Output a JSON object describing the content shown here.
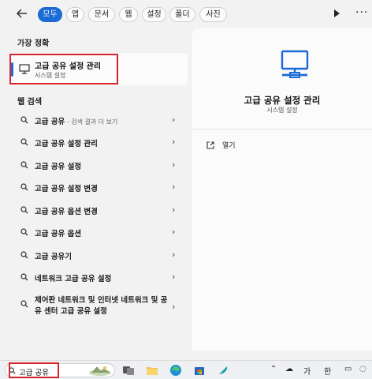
{
  "tabs": [
    {
      "label": "모두",
      "active": true
    },
    {
      "label": "앱",
      "active": false
    },
    {
      "label": "문서",
      "active": false
    },
    {
      "label": "웹",
      "active": false
    },
    {
      "label": "설정",
      "active": false
    },
    {
      "label": "폴더",
      "active": false
    },
    {
      "label": "사진",
      "active": false
    }
  ],
  "best_match": {
    "section_label": "가장 정확",
    "title": "고급 공유 설정 관리",
    "subtitle": "시스템 설정",
    "icon": "network-settings-icon"
  },
  "web_search": {
    "section_label": "웹 검색",
    "results": [
      {
        "label": "고급 공유",
        "suffix": " - 검색 결과 더 보기"
      },
      {
        "label": "고급 공유 설정 관리",
        "suffix": ""
      },
      {
        "label": "고급 공유 설정",
        "suffix": ""
      },
      {
        "label": "고급 공유 설정 변경",
        "suffix": ""
      },
      {
        "label": "고급 공유 옵션 변경",
        "suffix": ""
      },
      {
        "label": "고급 공유 옵션",
        "suffix": ""
      },
      {
        "label": "고급 공유기",
        "suffix": ""
      },
      {
        "label": "네트워크 고급 공유 설정",
        "suffix": ""
      },
      {
        "label": "제어판 네트워크 및 인터넷 네트워크 및 공유 센터 고급 공유 설정",
        "suffix": ""
      }
    ]
  },
  "preview": {
    "title": "고급 공유 설정 관리",
    "subtitle": "시스템 설정",
    "open_label": "열기"
  },
  "taskbar": {
    "search_text": "고급 공유",
    "tray_ime": "가",
    "tray_lang": "한"
  },
  "colors": {
    "accent": "#1a6bd6",
    "highlight_box": "#d6262b"
  }
}
